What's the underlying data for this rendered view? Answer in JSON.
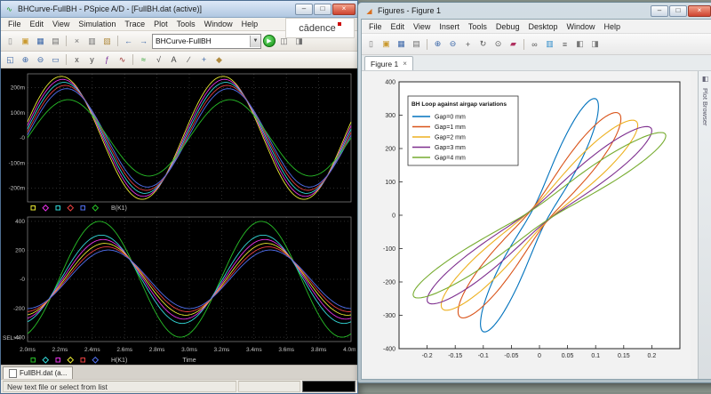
{
  "desktop": {
    "background": "#8a948c",
    "dot_color": "#5f6a62"
  },
  "pspice": {
    "window_title": "BHCurve-FullBH - PSpice A/D - [FullBH.dat (active)]",
    "menu": [
      "File",
      "Edit",
      "View",
      "Simulation",
      "Trace",
      "Plot",
      "Tools",
      "Window",
      "Help"
    ],
    "logo_text": "cādence",
    "doc_tab": "FullBH.dat (a...",
    "status_left": "New text file or select from list",
    "toolbar_main": {
      "icons_left": [
        {
          "name": "new-file",
          "glyph": "▯",
          "color": "#8a8a8a"
        },
        {
          "name": "open-file",
          "glyph": "▣",
          "color": "#c9992e"
        },
        {
          "name": "save-file",
          "glyph": "▦",
          "color": "#3a66a8"
        },
        {
          "name": "print",
          "glyph": "▤",
          "color": "#6f6f6f"
        },
        {
          "name": "cut",
          "glyph": "×",
          "color": "#6f6f6f"
        },
        {
          "name": "copy",
          "glyph": "▥",
          "color": "#6f6f6f"
        },
        {
          "name": "paste",
          "glyph": "▧",
          "color": "#b08a3e"
        },
        {
          "name": "undo",
          "glyph": "←",
          "color": "#3a66a8"
        },
        {
          "name": "redo",
          "glyph": "→",
          "color": "#3a66a8"
        }
      ],
      "profile_combo_value": "BHCurve-FullBH",
      "run_button": {
        "name": "run-simulation",
        "glyph": "▶",
        "color": "#1f9e23"
      },
      "icons_right": [
        {
          "name": "view-simulation-output",
          "glyph": "◫",
          "color": "#6f6f6f"
        },
        {
          "name": "view-circuit-file",
          "glyph": "◨",
          "color": "#6f6f6f"
        }
      ]
    },
    "toolbar_chart": {
      "icons": [
        {
          "name": "zoom-fit",
          "glyph": "◱",
          "color": "#3a66a8"
        },
        {
          "name": "zoom-in",
          "glyph": "⊕",
          "color": "#3a66a8"
        },
        {
          "name": "zoom-out",
          "glyph": "⊖",
          "color": "#3a66a8"
        },
        {
          "name": "zoom-area",
          "glyph": "▭",
          "color": "#3a66a8"
        },
        {
          "name": "log-x-axis",
          "glyph": "x",
          "color": "#444444"
        },
        {
          "name": "log-y-axis",
          "glyph": "y",
          "color": "#444444"
        },
        {
          "name": "fourier",
          "glyph": "ƒ",
          "color": "#7a2e9a"
        },
        {
          "name": "performance-analysis",
          "glyph": "∿",
          "color": "#9a2e2e"
        },
        {
          "name": "add-trace",
          "glyph": "≈",
          "color": "#1f9e23"
        },
        {
          "name": "eval-goal-function",
          "glyph": "√",
          "color": "#444444"
        },
        {
          "name": "insert-text-label",
          "glyph": "A",
          "color": "#444444"
        },
        {
          "name": "insert-line",
          "glyph": "∕",
          "color": "#444444"
        },
        {
          "name": "toggle-cursor",
          "glyph": "+",
          "color": "#3a66a8"
        },
        {
          "name": "mark-data-points",
          "glyph": "◆",
          "color": "#b08a3e"
        }
      ]
    },
    "chart": {
      "bg": "#000000",
      "grid_color": "#3f3f3f",
      "frame_color": "#8c8c8c",
      "text_color": "#c4c4c4",
      "xlabel": "Time",
      "sel_label": "SEL>>",
      "cycles": 2,
      "time_ticks": [
        {
          "t": 2.0,
          "label": "2.0ms"
        },
        {
          "t": 2.2,
          "label": "2.2ms"
        },
        {
          "t": 2.4,
          "label": "2.4ms"
        },
        {
          "t": 2.6,
          "label": "2.6ms"
        },
        {
          "t": 2.8,
          "label": "2.8ms"
        },
        {
          "t": 3.0,
          "label": "3.0ms"
        },
        {
          "t": 3.2,
          "label": "3.2ms"
        },
        {
          "t": 3.4,
          "label": "3.4ms"
        },
        {
          "t": 3.6,
          "label": "3.6ms"
        },
        {
          "t": 3.8,
          "label": "3.8ms"
        },
        {
          "t": 4.0,
          "label": "4.0ms"
        }
      ],
      "plots": [
        {
          "id": "top",
          "ylim": 255,
          "legend_label": "B(K1)",
          "yticks": [
            {
              "v": 200,
              "label": "200m"
            },
            {
              "v": 100,
              "label": "100m"
            },
            {
              "v": 0,
              "label": "-0"
            },
            {
              "v": -100,
              "label": "-100m"
            },
            {
              "v": -200,
              "label": "-200m"
            }
          ],
          "series": [
            {
              "name": "B-trace-1",
              "color": "#e8e832",
              "amplitude": 245,
              "phase_deg": 15
            },
            {
              "name": "B-trace-2",
              "color": "#e832e8",
              "amplitude": 233,
              "phase_deg": 12
            },
            {
              "name": "B-trace-3",
              "color": "#32d8d8",
              "amplitude": 221,
              "phase_deg": 9
            },
            {
              "name": "B-trace-4",
              "color": "#e84040",
              "amplitude": 209,
              "phase_deg": 6
            },
            {
              "name": "B-trace-5",
              "color": "#5070f0",
              "amplitude": 196,
              "phase_deg": 3
            },
            {
              "name": "B-trace-6",
              "color": "#28c028",
              "amplitude": 152,
              "phase_deg": 0
            }
          ]
        },
        {
          "id": "bottom",
          "ylim": 430,
          "legend_label": "H(K1)",
          "yticks": [
            {
              "v": 400,
              "label": "400"
            },
            {
              "v": 200,
              "label": "200"
            },
            {
              "v": 0,
              "label": "-0"
            },
            {
              "v": -200,
              "label": "-200"
            },
            {
              "v": -400,
              "label": "-400"
            }
          ],
          "series": [
            {
              "name": "H-trace-1",
              "color": "#28c028",
              "amplitude": 400,
              "phase_deg": -70
            },
            {
              "name": "H-trace-2",
              "color": "#32d8d8",
              "amplitude": 305,
              "phase_deg": -74
            },
            {
              "name": "H-trace-3",
              "color": "#e832e8",
              "amplitude": 275,
              "phase_deg": -78
            },
            {
              "name": "H-trace-4",
              "color": "#e8e832",
              "amplitude": 248,
              "phase_deg": -82
            },
            {
              "name": "H-trace-5",
              "color": "#e84040",
              "amplitude": 224,
              "phase_deg": -86
            },
            {
              "name": "H-trace-6",
              "color": "#5070f0",
              "amplitude": 202,
              "phase_deg": -90
            }
          ]
        }
      ]
    }
  },
  "matlab": {
    "window_title": "Figures - Figure 1",
    "menu": [
      "File",
      "Edit",
      "View",
      "Insert",
      "Tools",
      "Debug",
      "Desktop",
      "Window",
      "Help"
    ],
    "figure_tab": "Figure 1",
    "sidebar_label": "Plot Browser",
    "toolbar": {
      "icons": [
        {
          "name": "new-figure",
          "glyph": "▯",
          "color": "#777777"
        },
        {
          "name": "open-file",
          "glyph": "▣",
          "color": "#c9992e"
        },
        {
          "name": "save-figure",
          "glyph": "▦",
          "color": "#3a66a8"
        },
        {
          "name": "print-figure",
          "glyph": "▤",
          "color": "#6f6f6f"
        },
        {
          "name": "zoom-in",
          "glyph": "⊕",
          "color": "#3a66a8"
        },
        {
          "name": "zoom-out",
          "glyph": "⊖",
          "color": "#3a66a8"
        },
        {
          "name": "pan",
          "glyph": "+",
          "color": "#555555"
        },
        {
          "name": "rotate-3d",
          "glyph": "↻",
          "color": "#555555"
        },
        {
          "name": "data-cursor",
          "glyph": "⊙",
          "color": "#555555"
        },
        {
          "name": "brush",
          "glyph": "▰",
          "color": "#b03060"
        },
        {
          "name": "link-plot",
          "glyph": "∞",
          "color": "#555555"
        },
        {
          "name": "insert-colorbar",
          "glyph": "▥",
          "color": "#2e8bc9"
        },
        {
          "name": "insert-legend",
          "glyph": "≡",
          "color": "#555555"
        },
        {
          "name": "hide-plot-tools",
          "glyph": "◧",
          "color": "#777777"
        },
        {
          "name": "show-plot-tools",
          "glyph": "◨",
          "color": "#777777"
        }
      ]
    },
    "chart_data": {
      "type": "line",
      "legend_title": "BH Loop against airgap variations",
      "legend_position": "northwest",
      "xlim": [
        -0.25,
        0.25
      ],
      "ylim": [
        -400,
        400
      ],
      "xticks": [
        -0.2,
        -0.15,
        -0.1,
        -0.05,
        0,
        0.05,
        0.1,
        0.15,
        0.2
      ],
      "yticks": [
        -400,
        -300,
        -200,
        -100,
        0,
        100,
        200,
        300,
        400
      ],
      "grid": false,
      "series": [
        {
          "name": "Gap=0 mm",
          "color": "#0072BD",
          "x_amplitude": 0.105,
          "y_amplitude": 350,
          "phase_deg": 16
        },
        {
          "name": "Gap=1 mm",
          "color": "#D95319",
          "x_amplitude": 0.145,
          "y_amplitude": 308,
          "phase_deg": 15
        },
        {
          "name": "Gap=2 mm",
          "color": "#EDB120",
          "x_amplitude": 0.175,
          "y_amplitude": 285,
          "phase_deg": 14
        },
        {
          "name": "Gap=3 mm",
          "color": "#7E2F8E",
          "x_amplitude": 0.2,
          "y_amplitude": 266,
          "phase_deg": 13
        },
        {
          "name": "Gap=4 mm",
          "color": "#77AC30",
          "x_amplitude": 0.225,
          "y_amplitude": 248,
          "phase_deg": 12
        }
      ],
      "model_note": "Each series is a hysteresis loop: x=Xa*f(t), y=Ya*f(t+phase), f=peaked sine"
    }
  }
}
